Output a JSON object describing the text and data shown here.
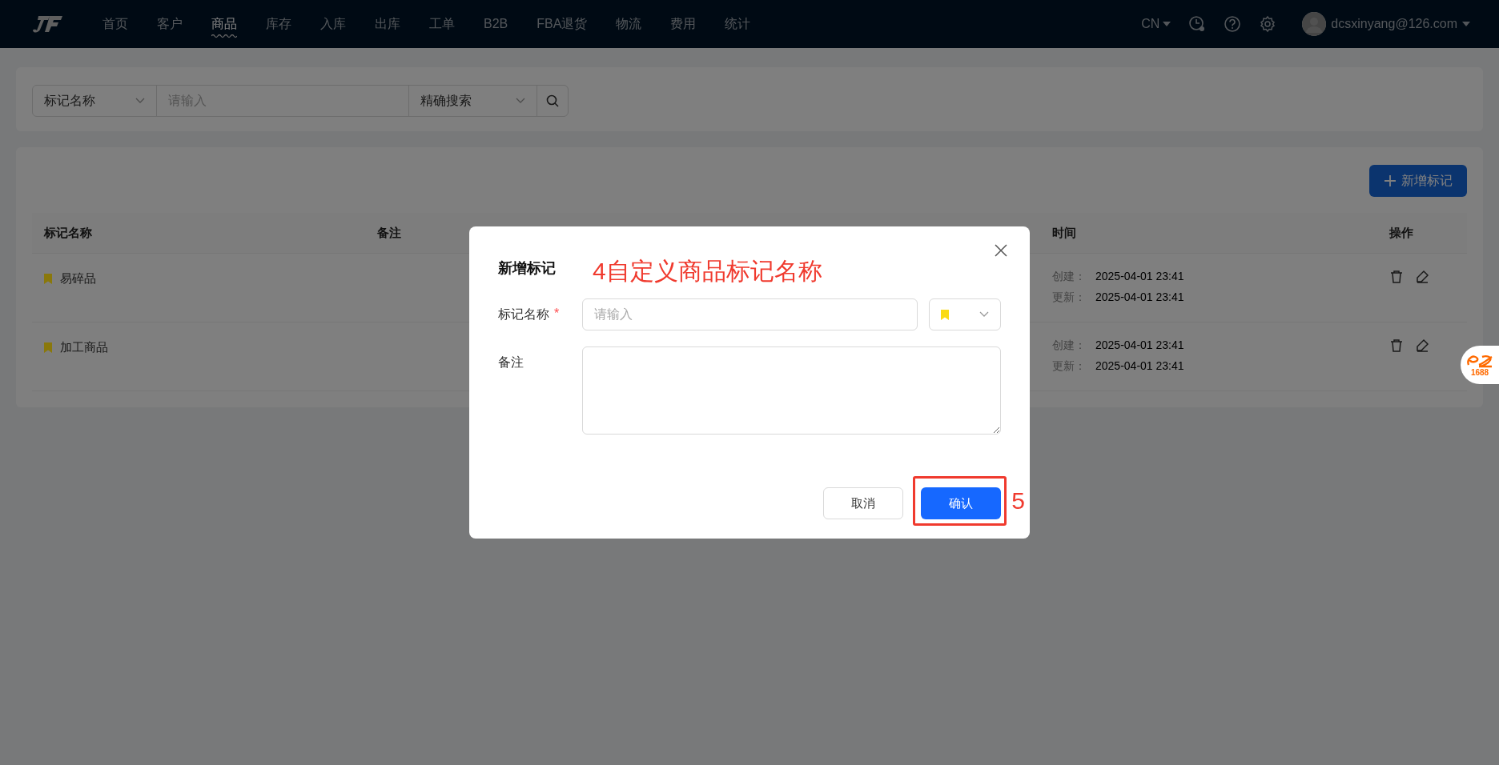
{
  "nav": {
    "menu": [
      {
        "label": "首页",
        "selected": false
      },
      {
        "label": "客户",
        "selected": false
      },
      {
        "label": "商品",
        "selected": true
      },
      {
        "label": "库存",
        "selected": false
      },
      {
        "label": "入库",
        "selected": false
      },
      {
        "label": "出库",
        "selected": false
      },
      {
        "label": "工单",
        "selected": false
      },
      {
        "label": "B2B",
        "selected": false
      },
      {
        "label": "FBA退货",
        "selected": false
      },
      {
        "label": "物流",
        "selected": false
      },
      {
        "label": "费用",
        "selected": false
      },
      {
        "label": "统计",
        "selected": false
      }
    ],
    "language": "CN",
    "user": "dcsxinyang@126.com"
  },
  "search": {
    "field_select": "标记名称",
    "placeholder": "请输入",
    "mode_select": "精确搜索"
  },
  "add_button": "新增标记",
  "table": {
    "columns": [
      "标记名称",
      "备注",
      "",
      "时间",
      "操作"
    ],
    "rows": [
      {
        "name": "易碎品",
        "color": "#8a780b",
        "created_label": "创建：",
        "created": "2025-04-01 23:41",
        "updated_label": "更新：",
        "updated": "2025-04-01 23:41"
      },
      {
        "name": "加工商品",
        "color": "#8a780b",
        "created_label": "创建：",
        "created": "2025-04-01 23:41",
        "updated_label": "更新：",
        "updated": "2025-04-01 23:41"
      }
    ]
  },
  "dialog": {
    "title": "新增标记",
    "name_label": "标记名称",
    "required_mark": "*",
    "name_placeholder": "请输入",
    "tag_select": {
      "color": "#fadb14"
    },
    "remark_label": "备注",
    "cancel": "取消",
    "confirm": "确认"
  },
  "annotations": {
    "step_4": "4自定义商品标记名称",
    "step_5": "5"
  },
  "floating_badge": "1688"
}
